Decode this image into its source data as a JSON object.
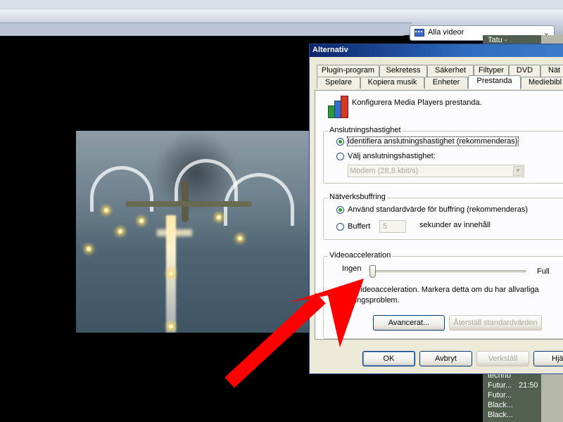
{
  "toolbar": {
    "library_dropdown": {
      "label": "Alla videor",
      "icon": "video-icon"
    }
  },
  "playlist": {
    "top_item": "Tatu -",
    "items": [
      {
        "title": "techno",
        "duration": ""
      },
      {
        "title": "Futur...",
        "duration": "21:50"
      },
      {
        "title": "Futur...",
        "duration": ""
      },
      {
        "title": "Black...",
        "duration": ""
      },
      {
        "title": "Black...",
        "duration": ""
      }
    ]
  },
  "dialog": {
    "title": "Alternativ",
    "tabs_row1": [
      "Plugin-program",
      "Sekretess",
      "Säkerhet",
      "Filtyper",
      "DVD",
      "Nät"
    ],
    "tabs_row2": [
      "Spelare",
      "Kopiera musik",
      "Enheter",
      "Prestanda",
      "Mediebibl"
    ],
    "active_tab": "Prestanda",
    "heading": "Konfigurera Media Players prestanda.",
    "connection": {
      "group_label": "Anslutningshastighet",
      "option_detect": "Identifiera anslutningshastighet (rekommenderas)",
      "option_choose": "Välj anslutningshastighet:",
      "speed_value": "Modem (28,8 kbit/s)",
      "selected": "detect"
    },
    "buffering": {
      "group_label": "Nätverksbuffring",
      "option_default": "Använd standardvärde för buffring (rekommenderas)",
      "option_buffer": "Buffert",
      "seconds_value": "5",
      "seconds_suffix": "sekunder av innehåll",
      "selected": "default"
    },
    "video_acceleration": {
      "group_label": "Videoacceleration",
      "min_label": "Ingen",
      "max_label": "Full",
      "level": 0,
      "description_line1": "videoacceleration. Markera detta om du har allvarliga",
      "description_line2": "elningsproblem.",
      "advanced_button": "Avancerat...",
      "reset_button": "Återställ standardvärden"
    },
    "buttons": {
      "ok": "OK",
      "cancel": "Avbryt",
      "apply": "Verkställ",
      "help": "Hjä"
    }
  },
  "colors": {
    "annotation_arrow": "#ff0000",
    "title_bar": "#0a246a",
    "playlist_bg": "#515f4f"
  }
}
